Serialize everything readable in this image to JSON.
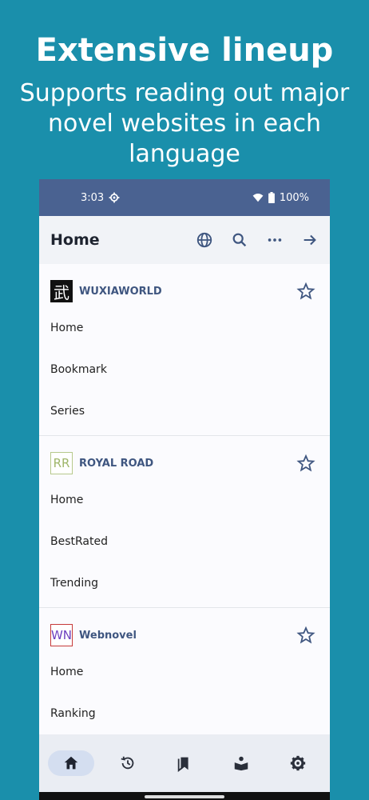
{
  "promo": {
    "title": "Extensive lineup",
    "subtitle": "Supports reading out major novel websites in each language"
  },
  "statusbar": {
    "time": "3:03",
    "battery": "100%",
    "icons": [
      "settings-gear-icon",
      "wifi-icon",
      "battery-icon"
    ]
  },
  "appbar": {
    "title": "Home",
    "icons": [
      "globe-icon",
      "search-icon",
      "more-horizontal-icon",
      "arrow-forward-icon"
    ]
  },
  "sites": [
    {
      "name": "WUXIAWORLD",
      "logo": "武",
      "links": [
        "Home",
        "Bookmark",
        "Series"
      ]
    },
    {
      "name": "ROYAL ROAD",
      "logo": "RR",
      "links": [
        "Home",
        "BestRated",
        "Trending"
      ]
    },
    {
      "name": "Webnovel",
      "logo": "WN",
      "links": [
        "Home",
        "Ranking"
      ]
    }
  ],
  "bottomnav": {
    "items": [
      "home-icon",
      "history-icon",
      "bookmarks-icon",
      "reading-icon",
      "settings-icon"
    ],
    "active": "home-icon"
  },
  "colors": {
    "background": "#1a8fab",
    "statusbar": "#4a6291",
    "accent": "#3f5680"
  }
}
